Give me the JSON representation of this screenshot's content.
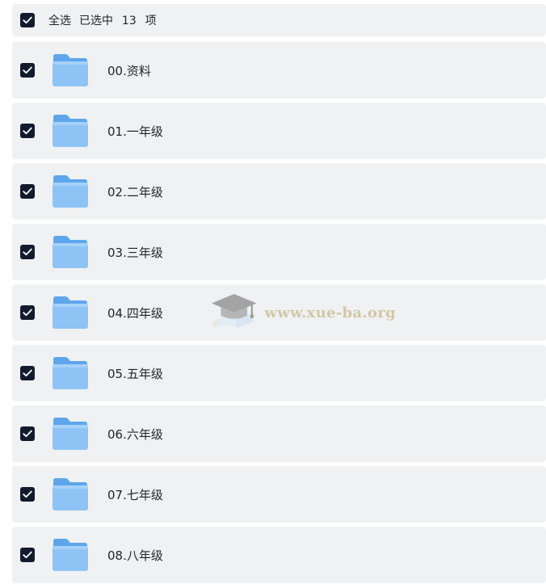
{
  "header": {
    "select_all_label": "全选",
    "selected_prefix": "已选中",
    "selected_count": "13",
    "selected_suffix": "项"
  },
  "folders": [
    {
      "name": "00.资料"
    },
    {
      "name": "01.一年级"
    },
    {
      "name": "02.二年级"
    },
    {
      "name": "03.三年级"
    },
    {
      "name": "04.四年级"
    },
    {
      "name": "05.五年级"
    },
    {
      "name": "06.六年级"
    },
    {
      "name": "07.七年级"
    },
    {
      "name": "08.八年级"
    }
  ],
  "watermark": {
    "text": "www.xue-ba.org"
  },
  "colors": {
    "checkbox": "#121a2e",
    "row_background": "#f0f1f3",
    "folder_blue": "#7cb8f2"
  },
  "icons": {
    "checkbox": "checkmark-icon",
    "folder": "folder-icon",
    "watermark": "graduation-cap-icon"
  }
}
